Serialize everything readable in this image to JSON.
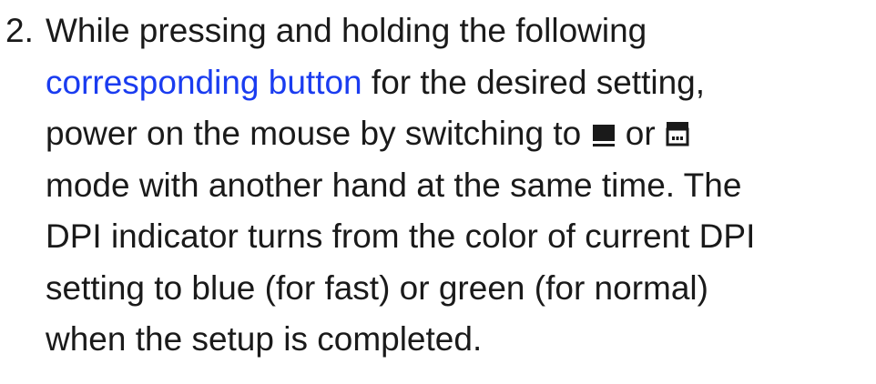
{
  "step": {
    "number": "2.",
    "line1": "While pressing and holding the following",
    "link_text": "corresponding button",
    "line2_rest": " for the desired setting,",
    "line3_a": "power on the mouse by switching to ",
    "line3_or": " or ",
    "line4": "mode with another hand at the same time. The",
    "line5": "DPI indicator turns from the color of current DPI",
    "line6": "setting to blue (for fast) or green (for normal)",
    "line7": "when the setup is completed."
  },
  "icons": {
    "mode_a": "wired-mode-icon",
    "mode_b": "wireless-dongle-mode-icon"
  },
  "colors": {
    "text": "#1a1a1a",
    "link": "#1a3cf0"
  }
}
